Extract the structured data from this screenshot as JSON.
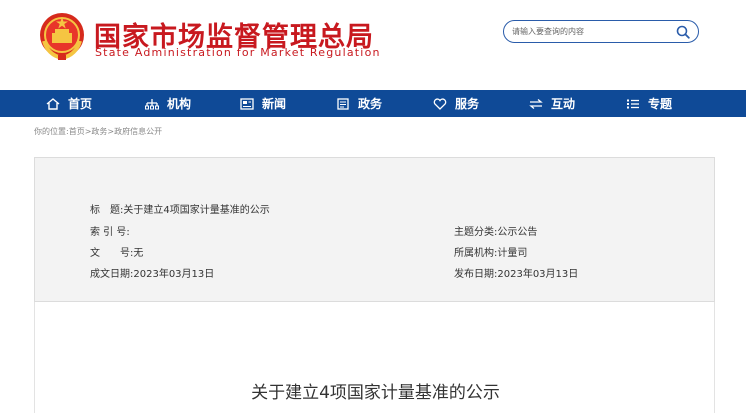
{
  "header": {
    "title": "国家市场监督管理总局",
    "subtitle": "State Administration for Market Regulation",
    "colors": {
      "brand_red": "#c8191f",
      "nav_blue": "#0f4a97"
    }
  },
  "search": {
    "placeholder": "请输入要查询的内容",
    "icon": "search-icon"
  },
  "nav": {
    "items": [
      {
        "label": "首页",
        "icon": "home-icon"
      },
      {
        "label": "机构",
        "icon": "org-icon"
      },
      {
        "label": "新闻",
        "icon": "news-icon"
      },
      {
        "label": "政务",
        "icon": "affairs-icon"
      },
      {
        "label": "服务",
        "icon": "heart-icon"
      },
      {
        "label": "互动",
        "icon": "interact-icon"
      },
      {
        "label": "专题",
        "icon": "list-icon"
      }
    ]
  },
  "breadcrumb": "你的位置:首页>政务>政府信息公开",
  "info": {
    "title_label": "标　题:",
    "title_value": "关于建立4项国家计量基准的公示",
    "index_label": "索 引 号:",
    "index_value": "",
    "doc_label": "文　　号:",
    "doc_value": "无",
    "created_label": "成文日期:",
    "created_value": "2023年03月13日",
    "topic_label": "主题分类:",
    "topic_value": "公示公告",
    "dept_label": "所属机构:",
    "dept_value": "计量司",
    "published_label": "发布日期:",
    "published_value": "2023年03月13日"
  },
  "article": {
    "title": "关于建立4项国家计量基准的公示"
  }
}
